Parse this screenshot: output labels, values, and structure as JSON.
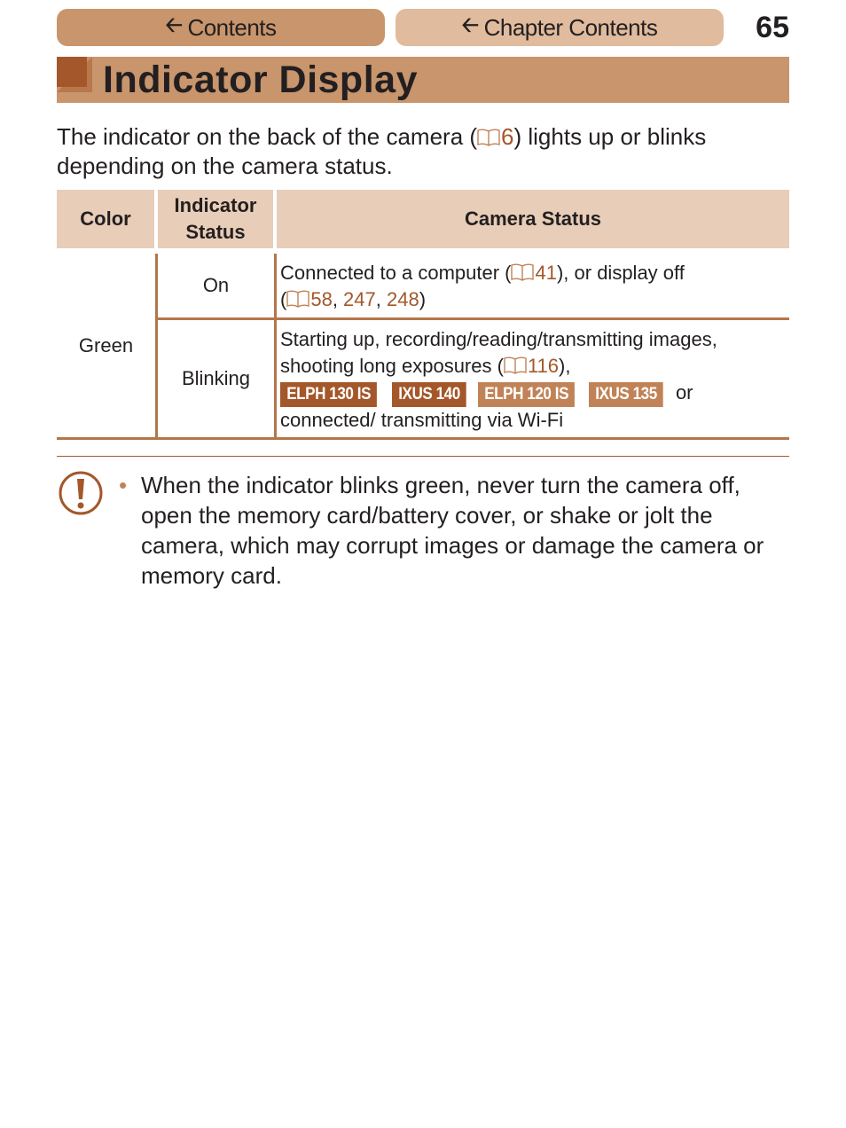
{
  "nav": {
    "contents_label": "Contents",
    "chapter_contents_label": "Chapter Contents",
    "arrow_icon": "left-arrow-icon"
  },
  "page_number": "65",
  "title": "Indicator Display",
  "intro": {
    "text_before": "The indicator on the back of the camera (",
    "ref": "6",
    "text_after": ") lights up or blinks depending on the camera status."
  },
  "table": {
    "headers": [
      "Color",
      "Indicator Status",
      "Camera Status"
    ],
    "color": "Green",
    "rows": [
      {
        "indicator": "On",
        "desc_1": "Connected to a computer (",
        "ref_1": "41",
        "desc_2": "), or display off",
        "desc_3": "(",
        "refs": [
          "58",
          "247",
          "248"
        ],
        "desc_4": ")"
      },
      {
        "indicator": "Blinking",
        "desc_1": "Starting up, recording/reading/transmitting images, shooting long exposures (",
        "ref_1": "116",
        "desc_2": "),",
        "badges": [
          "ELPH 130 IS",
          "IXUS 140",
          "ELPH 120 IS",
          "IXUS 135"
        ],
        "desc_3": "or connected/ transmitting via Wi-Fi"
      }
    ]
  },
  "caution": {
    "icon": "caution-icon",
    "text": "When the indicator blinks green, never turn the camera off, open the memory card/battery cover, or shake or jolt the camera, which may corrupt images or damage the camera or memory card."
  },
  "colors": {
    "brand_dark": "#a4572a",
    "brand_mid": "#c8956c",
    "brand_light": "#e0bb9d",
    "table_header": "#e8cdb8"
  }
}
